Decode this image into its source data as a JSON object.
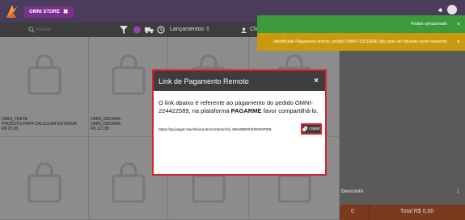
{
  "header": {
    "store_tab_label": "OMNI STORE",
    "store_tab_close": "✖"
  },
  "toolbar": {
    "search_placeholder": "Buscar",
    "launch_label": "Lançamentos ⇳",
    "client_label": "Clien"
  },
  "products": [
    {
      "name": "OMNI_FRETE",
      "description": "PRODUTO PARA CALCULAR ENTREGA",
      "price": "R$ 20,00"
    },
    {
      "name": "OMNI_DECIMAL",
      "description": "OMNI_DECIMAL",
      "price": "R$ 121,88"
    }
  ],
  "panel": {
    "discount_label": "Desconto",
    "discount_value": "1",
    "quantity": "0",
    "total": "Total R$ 0,00"
  },
  "toasts": {
    "success": "Pedido armazenado",
    "warning": "Identificado Pagamento remoto, pedido OMNI-753216686 não pode ser faturado neste momento",
    "close": "×"
  },
  "modal": {
    "title": "Link de Pagamento Remoto",
    "close": "×",
    "text_before": "O link abaixo é referente ao pagamento do pedido OMNI-224422589, na plataforma ",
    "platform": "PAGARME",
    "text_after": " favor compartilhá-lo.",
    "link": "https://api.pagar.me/checkout/v1/orders/chk_59m6BEDhZh5GNPZM",
    "copy_label": "copiar"
  },
  "colors": {
    "topbar": "#4a3d5c",
    "accent_purple": "#7b2e8e",
    "success": "#3d9a3b",
    "warning": "#c99a0e",
    "highlight": "#d4242a",
    "total_bar": "#7a3a1e"
  }
}
